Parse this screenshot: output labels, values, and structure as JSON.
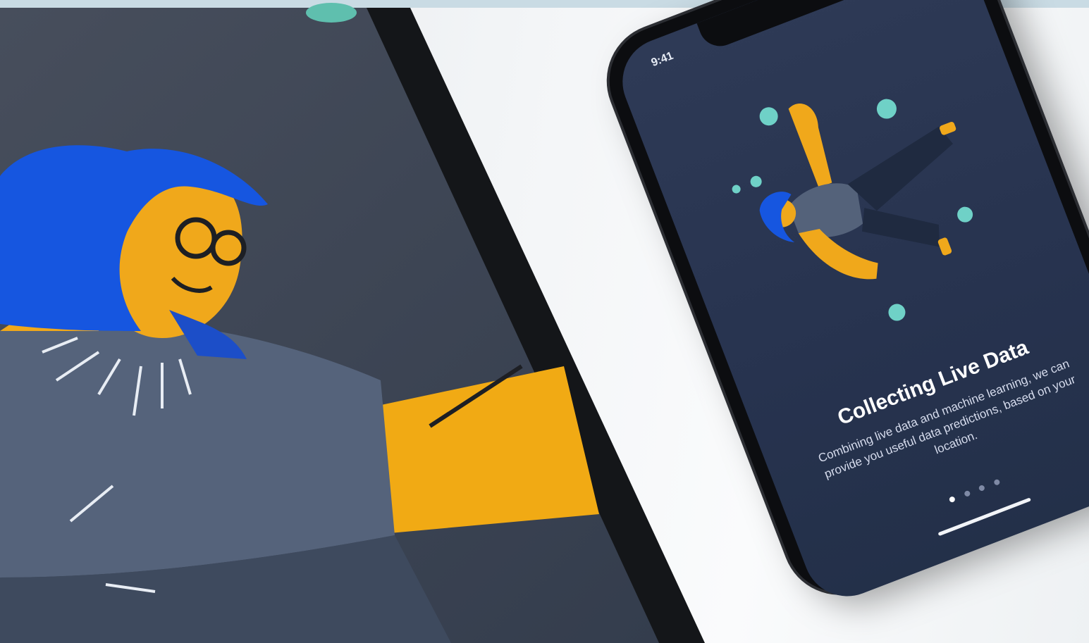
{
  "phone": {
    "status_time": "9:41",
    "status_icons": "▮ ᯤ ▬",
    "onboarding": {
      "title": "Collecting Live Data",
      "body": "Combining live data and machine learning, we can provide you useful data predictions, based on your location.",
      "page_count": 4,
      "active_page": 1
    }
  },
  "colors": {
    "screen_bg": "#2b3653",
    "tablet_bg": "#3b4556",
    "hair_blue": "#1656e0",
    "skin_yellow": "#f0a81b",
    "shirt_slate": "#54627a",
    "orb_teal": "#6fd1c7"
  },
  "icons": [
    "signal-icon",
    "wifi-icon",
    "battery-icon"
  ]
}
